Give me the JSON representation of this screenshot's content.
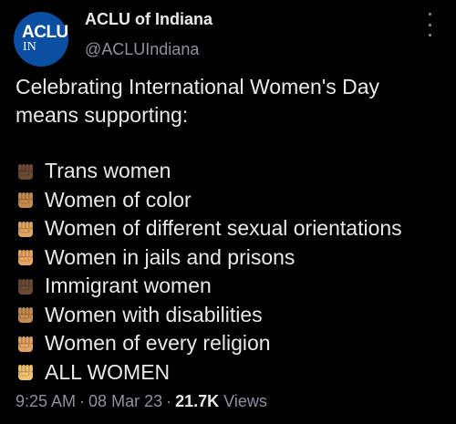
{
  "author": {
    "avatar_top": "ACLU",
    "avatar_bottom": "IN",
    "display_name": "ACLU of Indiana",
    "handle": "@ACLUIndiana"
  },
  "tweet": {
    "intro_line1": "Celebrating International Women's Day",
    "intro_line2": "means supporting:",
    "items": [
      {
        "text": "Trans women",
        "fist_color": "#6b4a35"
      },
      {
        "text": "Women of color",
        "fist_color": "#c58a4f"
      },
      {
        "text": "Women of different sexual orientations",
        "fist_color": "#e0a462"
      },
      {
        "text": "Women in jails and prisons",
        "fist_color": "#e6a660"
      },
      {
        "text": "Immigrant women",
        "fist_color": "#6b4a35"
      },
      {
        "text": "Women with disabilities",
        "fist_color": "#c58a4f"
      },
      {
        "text": "Women of every religion",
        "fist_color": "#e0a462"
      },
      {
        "text": "ALL WOMEN",
        "fist_color": "#f0c070"
      }
    ]
  },
  "meta": {
    "time": "9:25 AM",
    "date": "08 Mar 23",
    "views_count": "21.7K",
    "views_label": "Views"
  },
  "icons": {
    "more": "more-options-icon",
    "list_bullet": "raised-fist-icon"
  },
  "colors": {
    "background": "#000000",
    "text": "#e7e9ea",
    "secondary": "#8b9299",
    "avatar_bg": "#0b4fa2"
  }
}
